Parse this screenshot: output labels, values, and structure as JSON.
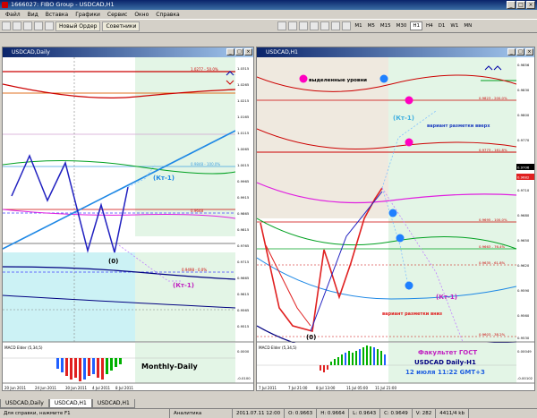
{
  "app": {
    "title": "1666027: FIBO Group - USDCAD,H1"
  },
  "menu": [
    "Файл",
    "Вид",
    "Вставка",
    "Графики",
    "Сервис",
    "Окно",
    "Справка"
  ],
  "toolbar": {
    "new_order": "Новый Ордер",
    "advisors": "Советники",
    "timeframes": [
      "M1",
      "M5",
      "M15",
      "M30",
      "H1",
      "H4",
      "D1",
      "W1",
      "MN"
    ],
    "active_tf": "H1"
  },
  "left_chart": {
    "title": "USDCAD,Daily",
    "prices": [
      "1.0315",
      "1.0290",
      "1.0265",
      "1.0240",
      "1.0215",
      "1.0190",
      "1.0165",
      "1.0140",
      "1.0115",
      "1.0090",
      "1.0065",
      "1.0040",
      "1.0015",
      "0.9990",
      "0.9965",
      "0.9940",
      "0.9915",
      "0.9890",
      "0.9865",
      "0.9840",
      "0.9815",
      "0.9790",
      "0.9765",
      "0.9740",
      "0.9715",
      "0.9690",
      "0.9665",
      "0.9640",
      "0.9615",
      "0.9590",
      "0.9565",
      "0.9540",
      "0.9515",
      "0.9490",
      "0.9465",
      "0.9440"
    ],
    "kt_label": "(Кт-1)",
    "kt_label2": "(Кт-1)",
    "zero_label": "(0)",
    "fib_labels": [
      "1.0277 - 50.0%",
      "0.9848 - 100.0%",
      "0.9648",
      "0.9498 - 0.0%"
    ],
    "macd_label": "MACD Elder (5,34,5)",
    "macd_right": [
      "0.0000",
      "-0.0100"
    ],
    "monthly": "Monthly-Daily",
    "dates": [
      "20 Jun 2011",
      "24 Jun 2011",
      "30 Jun 2011",
      "4 Jul 2011",
      "8 Jul 2011"
    ]
  },
  "right_chart": {
    "title": "USDCAD,H1",
    "legend_text": "выделенные уровни",
    "kt_label": "(Кт-1)",
    "kt_label2": "(Кт-1)",
    "up_variant": "вариант разметки вверх",
    "down_variant": "вариант разметки вниз",
    "zero_label": "(0)",
    "fib_labels": [
      "0.9823 - 200.0%",
      "0.9773 - 161.8%",
      "0.9695 - 100.0%",
      "0.9663 - 76.4%",
      "0.9635 - 61.8%",
      "0.9603 - 38.2%"
    ],
    "prices": [
      "0.9856",
      "0.9845",
      "0.9830",
      "0.9815",
      "0.9800",
      "0.9785",
      "0.9770",
      "0.9755",
      "0.9740",
      "0.9725",
      "0.9710",
      "0.9695",
      "0.9680",
      "0.9665",
      "0.9650",
      "0.9635",
      "0.9620",
      "0.9605",
      "0.9590",
      "0.9575",
      "0.9560",
      "0.9545",
      "0.9530"
    ],
    "bid": "0.9706",
    "ask": "0.9682",
    "macd_label": "MACD Elder (5,34,5)",
    "macd_right": [
      "0.00049",
      "-0.00102"
    ],
    "dates": [
      "7 Jul 2011",
      "7 Jul 21:00",
      "8 Jul 13:00",
      "11 Jul 05:00",
      "11 Jul 21:00"
    ],
    "info_line1": "Факультет ГОСТ",
    "info_line2": "USDCAD Daily-H1",
    "info_line3": "12 июля 11:22 GMT+3"
  },
  "tabs": [
    "USDCAD,Daily",
    "USDCAD,H1",
    "USDCAD,H1"
  ],
  "status": [
    "Для справки, нажмите F1",
    "Аналитика",
    "2011.07.11 12:00",
    "O: 0.9663",
    "H: 0.9664",
    "L: 0.9643",
    "C: 0.9649",
    "V: 282",
    "4411/4 kb"
  ]
}
